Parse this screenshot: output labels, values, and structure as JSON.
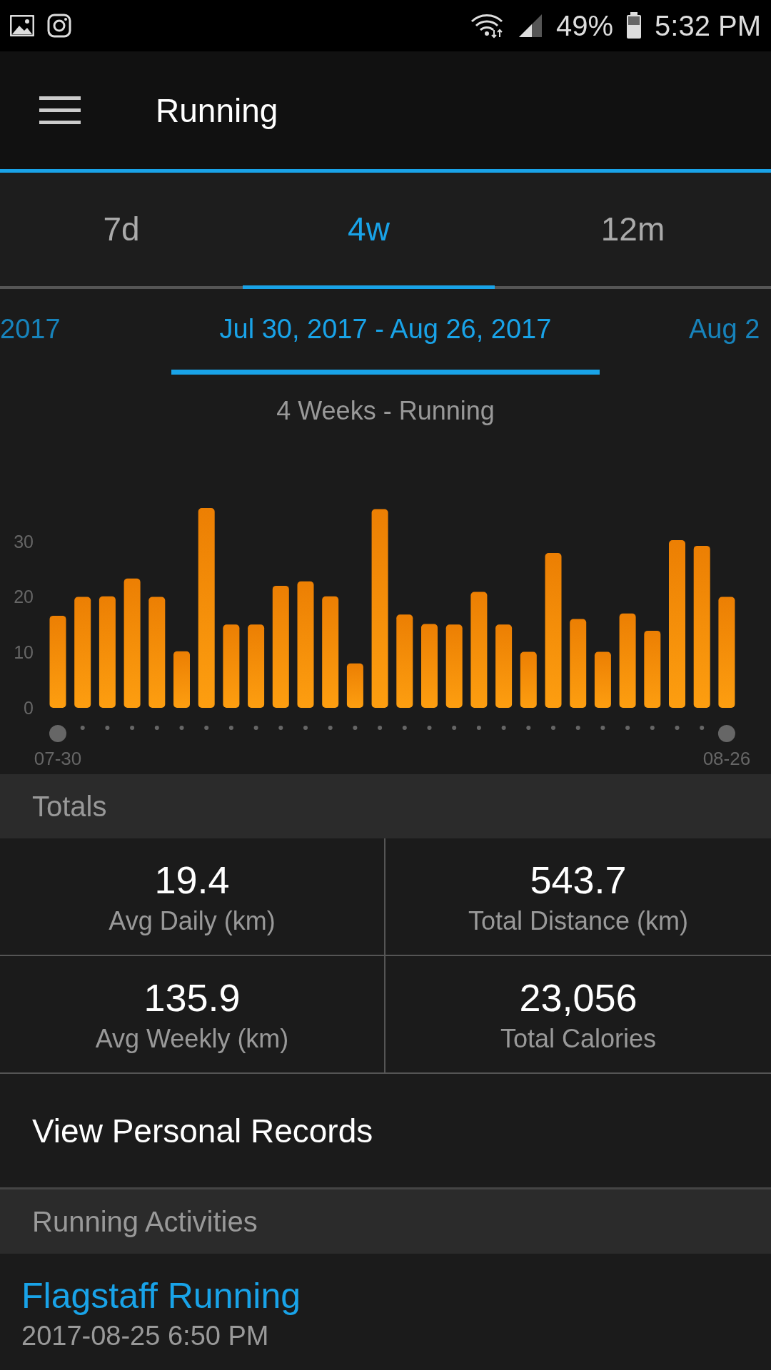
{
  "status_bar": {
    "battery": "49%",
    "time": "5:32 PM"
  },
  "app_bar": {
    "title": "Running"
  },
  "tabs": [
    {
      "label": "7d",
      "selected": false
    },
    {
      "label": "4w",
      "selected": true
    },
    {
      "label": "12m",
      "selected": false
    }
  ],
  "date_ranges": [
    {
      "label": "2017",
      "selected": false
    },
    {
      "label": "Jul 30, 2017 - Aug 26, 2017",
      "selected": true
    },
    {
      "label": "Aug 2",
      "selected": false
    }
  ],
  "chart": {
    "chart_data": {
      "type": "bar",
      "title": "4 Weeks - Running",
      "yticks": [
        {
          "value": 0,
          "label": "0"
        },
        {
          "value": 10,
          "label": "10"
        },
        {
          "value": 20,
          "label": "20"
        },
        {
          "value": 30,
          "label": "30"
        }
      ],
      "orientation": "vertical",
      "ylim": [
        0,
        36
      ],
      "categories": [
        "07-30",
        null,
        null,
        null,
        null,
        null,
        null,
        null,
        null,
        null,
        null,
        null,
        null,
        null,
        null,
        null,
        null,
        null,
        null,
        null,
        null,
        null,
        null,
        null,
        null,
        null,
        null,
        "08-26"
      ],
      "values": [
        16.6,
        20,
        20.1,
        23.3,
        20,
        10.2,
        36,
        15,
        15,
        22,
        22.8,
        20.1,
        8,
        35.8,
        16.8,
        15.1,
        15,
        20.9,
        15,
        10.1,
        27.9,
        16,
        10.1,
        17,
        13.9,
        30.2,
        29.2,
        20
      ]
    }
  },
  "totals": {
    "header": "Totals",
    "stats": [
      {
        "value": "19.4",
        "label": "Avg Daily (km)"
      },
      {
        "value": "543.7",
        "label": "Total Distance (km)"
      },
      {
        "value": "135.9",
        "label": "Avg Weekly (km)"
      },
      {
        "value": "23,056",
        "label": "Total Calories"
      }
    ]
  },
  "records_link": "View Personal Records",
  "activities": {
    "header": "Running Activities",
    "items": [
      {
        "name": "Flagstaff Running",
        "date": "2017-08-25 6:50 PM"
      }
    ]
  }
}
